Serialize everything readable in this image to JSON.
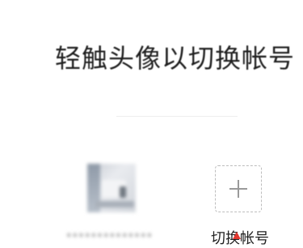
{
  "header": {
    "title": "轻触头像以切换帐号"
  },
  "accounts": [
    {
      "name": "••••••••••••••"
    }
  ],
  "add_account": {
    "label": "切换帐号"
  },
  "icons": {
    "add": "plus-icon",
    "pointer": "red-pointer-icon"
  },
  "colors": {
    "title": "#1f1f1f",
    "dashed_border": "#bdbdbd",
    "pointer": "#e2372f"
  }
}
